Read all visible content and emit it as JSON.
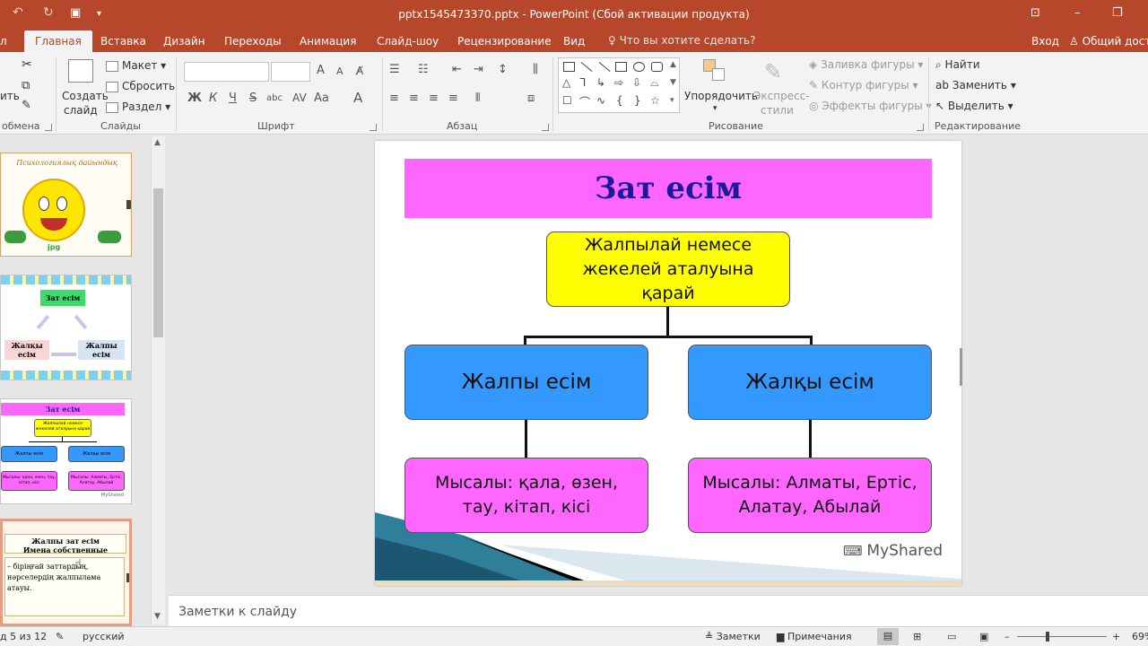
{
  "window": {
    "title": "pptx1545473370.pptx - PowerPoint (Сбой активации продукта)"
  },
  "ribbon": {
    "tabs": [
      "Главная",
      "Вставка",
      "Дизайн",
      "Переходы",
      "Анимация",
      "Слайд-шоу",
      "Рецензирование",
      "Вид"
    ],
    "file_tab_partial": "л",
    "tell_me": "Что вы хотите сделать?",
    "sign_in": "Вход",
    "share": "Общий дост",
    "clipboard": {
      "paste_partial": "ить",
      "label": "обмена"
    },
    "slides": {
      "new_slide_line1": "Создать",
      "new_slide_line2": "слайд",
      "layout": "Макет",
      "reset": "Сбросить",
      "section": "Раздел",
      "label": "Слайды"
    },
    "font": {
      "bold": "Ж",
      "italic": "К",
      "underline": "Ч",
      "strike": "S",
      "shadow": "abc",
      "grow": "A",
      "shrink": "A",
      "case": "Aa",
      "label": "Шрифт"
    },
    "paragraph": {
      "label": "Абзац"
    },
    "drawing": {
      "arrange": "Упорядочить",
      "quick_styles_line1": "Экспресс-",
      "quick_styles_line2": "стили",
      "fill": "Заливка фигуры",
      "outline": "Контур фигуры",
      "effects": "Эффекты фигуры",
      "label": "Рисование"
    },
    "editing": {
      "find": "Найти",
      "replace": "Заменить",
      "select": "Выделить",
      "label": "Редактирование"
    }
  },
  "thumbnails": {
    "t1": {
      "banner": "Психологиялық дайындық",
      "caption": "jpg"
    },
    "t2": {
      "title": "Зат есім",
      "left": "Жалқы есім",
      "right": "Жалпы есім"
    },
    "t3": {
      "title": "Зат есім",
      "top": "Жалпылай немесе жекелей аталуына қарай",
      "left": "Жалпы есім",
      "right": "Жалқы есім",
      "left_ex": "Мысалы: қала, өзен, тау, кітап, кісі",
      "right_ex": "Мысалы: Алматы, Ертіс, Алатау, Абылай",
      "wm": "MyShared"
    },
    "t4": {
      "title1": "Жалпы зат есім",
      "title2": "Имена собственные",
      "body": "– біріңғай заттардың, нәрселердің жалпылама атауы."
    }
  },
  "slide": {
    "title": "Зат есім",
    "top_box": "Жалпылай немесе жекелей аталуына қарай",
    "left_box": "Жалпы есім",
    "right_box": "Жалқы есім",
    "left_example": "Мысалы: қала, өзен, тау, кітап, кісі",
    "right_example": "Мысалы: Алматы, Ертіс, Алатау, Абылай",
    "watermark": "MyShared"
  },
  "notes_placeholder": "Заметки к слайду",
  "status": {
    "slide_of": "д 5 из 12",
    "language": "русский",
    "notes": "Заметки",
    "comments": "Примечания",
    "zoom": "69%"
  },
  "colors": {
    "accent": "#b7472a",
    "title_bar": "#ff66ff",
    "top_box": "#ffff00",
    "blue_box": "#3399ff",
    "pink_box": "#ff66ff"
  }
}
